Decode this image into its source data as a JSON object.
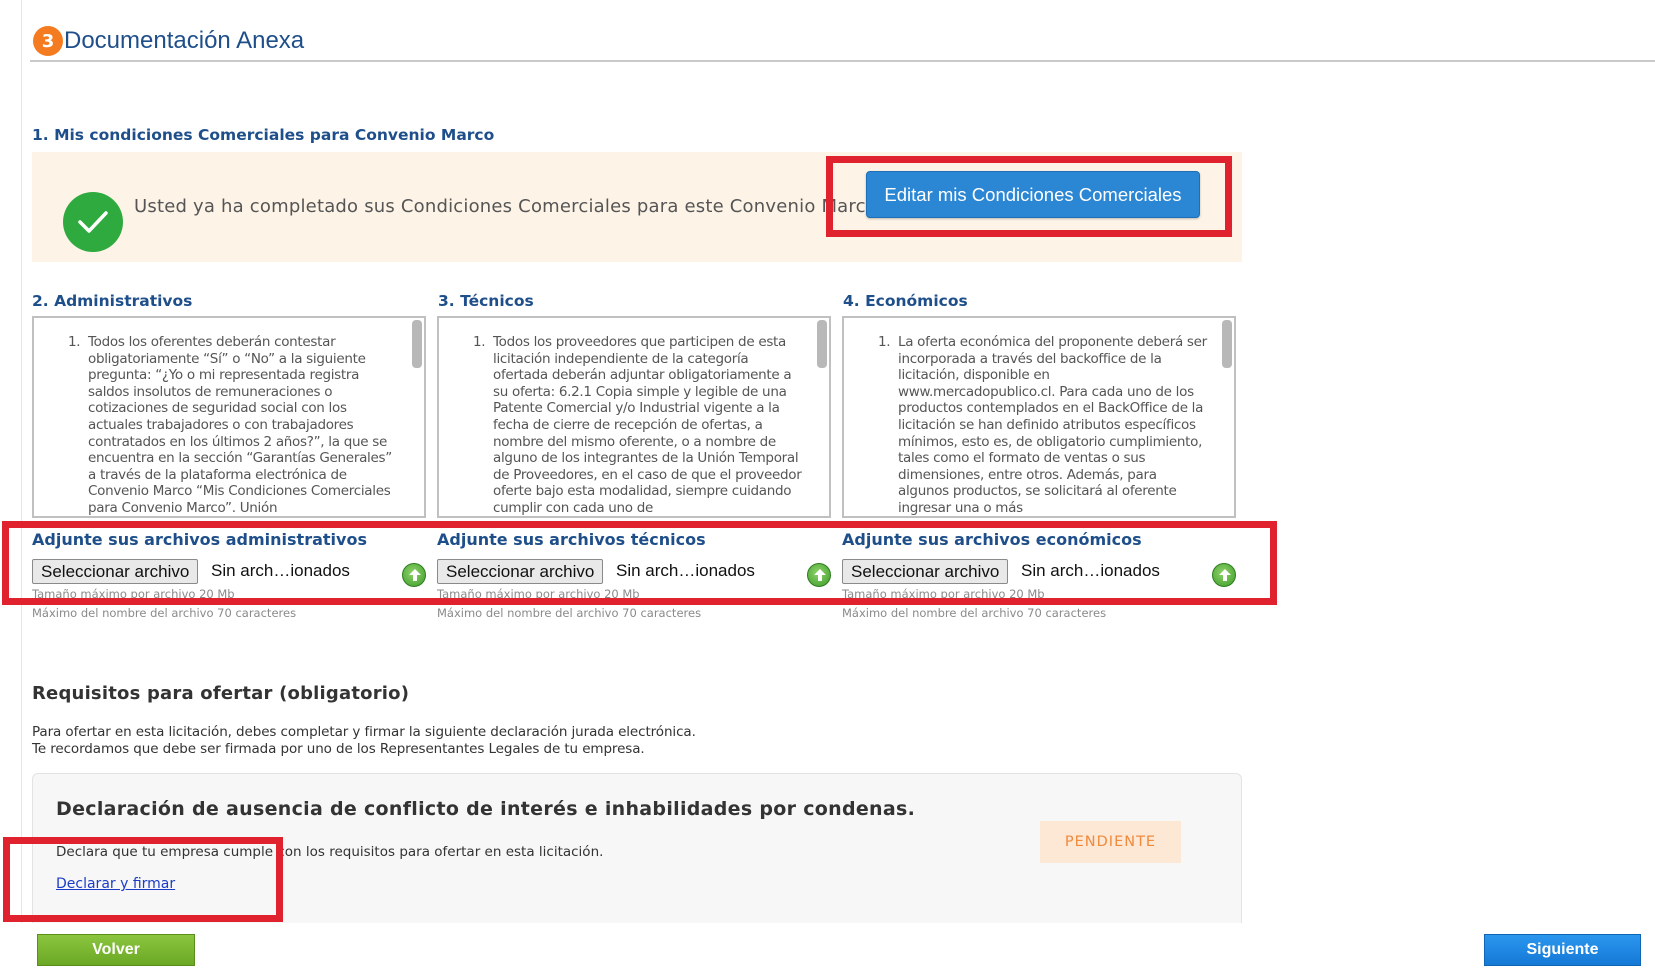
{
  "section": {
    "step_number": "3",
    "title": "Documentación Anexa"
  },
  "comerciales": {
    "heading": "1. Mis condiciones Comerciales para Convenio Marco",
    "message": "Usted ya ha completado sus Condiciones Comerciales para este Convenio Marco.",
    "edit_button": "Editar mis Condiciones Comerciales"
  },
  "columns": [
    {
      "heading": "2. Administrativos",
      "num": "1.",
      "text": "Todos los oferentes deberán contestar obligatoriamente “Sí” o “No” a la siguiente pregunta: “¿Yo o mi representada registra saldos insolutos de remuneraciones o cotizaciones de seguridad social con los actuales trabajadores o con trabajadores contratados en los últimos 2 años?”, la que se encuentra en la sección “Garantías Generales” a través de la plataforma electrónica de Convenio Marco “Mis Condiciones Comerciales para Convenio Marco”. Unión",
      "upload_label": "Adjunte sus archivos administrativos",
      "file_button": "Seleccionar archivo",
      "file_status": "Sin arch…ionados",
      "hint_size": "Tamaño máximo por archivo 20 Mb",
      "hint_name": "Máximo del nombre del archivo 70 caracteres"
    },
    {
      "heading": "3. Técnicos",
      "num": "1.",
      "text": "Todos los proveedores que participen de esta licitación independiente de la categoría ofertada deberán adjuntar obligatoriamente a su oferta: 6.2.1 Copia simple y legible de una Patente Comercial y/o Industrial vigente a la fecha de cierre de recepción de ofertas, a nombre del mismo oferente, o a nombre de alguno de los integrantes de la Unión Temporal de Proveedores, en el caso de que el proveedor oferte bajo esta modalidad, siempre cuidando cumplir con cada uno de",
      "upload_label": "Adjunte sus archivos técnicos",
      "file_button": "Seleccionar archivo",
      "file_status": "Sin arch…ionados",
      "hint_size": "Tamaño máximo por archivo 20 Mb",
      "hint_name": "Máximo del nombre del archivo 70 caracteres"
    },
    {
      "heading": "4. Económicos",
      "num": "1.",
      "text": "La oferta económica del proponente deberá ser incorporada a través del backoffice de la licitación, disponible en www.mercadopublico.cl. Para cada uno de los productos contemplados en el BackOffice de la licitación se han definido atributos específicos mínimos, esto es, de obligatorio cumplimiento, tales como el formato de ventas o sus dimensiones, entre otros. Además, para algunos productos, se solicitará al oferente ingresar una o más",
      "upload_label": "Adjunte sus archivos económicos",
      "file_button": "Seleccionar archivo",
      "file_status": "Sin arch…ionados",
      "hint_size": "Tamaño máximo por archivo 20 Mb",
      "hint_name": "Máximo del nombre del archivo 70 caracteres"
    }
  ],
  "requisitos": {
    "title": "Requisitos para ofertar (obligatorio)",
    "line1": "Para ofertar en esta licitación, debes completar y firmar la siguiente declaración jurada electrónica.",
    "line2": "Te recordamos que debe ser firmada por uno de los Representantes Legales de tu empresa.",
    "decl_title": "Declaración de ausencia de conflicto de interés e inhabilidades por condenas.",
    "decl_desc": "Declara que tu empresa cumple con los requisitos para ofertar en esta licitación.",
    "decl_link": "Declarar y firmar",
    "status": "PENDIENTE"
  },
  "footer": {
    "back": "Volver",
    "next": "Siguiente"
  },
  "colors": {
    "accent_blue": "#1f4f8a",
    "highlight_red": "#e0222e",
    "badge_orange": "#f47b20",
    "success_green": "#2faa3f"
  }
}
